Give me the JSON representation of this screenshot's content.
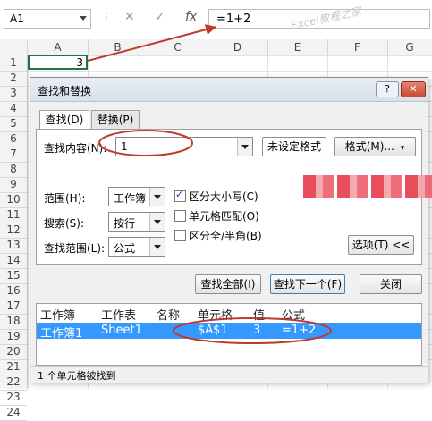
{
  "formula_bar": {
    "name_box": "A1",
    "separator": "⋮",
    "cancel_symbol": "✕",
    "enter_symbol": "✓",
    "fx_symbol": "fx",
    "formula": "=1+2",
    "watermark": "Excel教程之家"
  },
  "sheet": {
    "columns": [
      "A",
      "B",
      "C",
      "D",
      "E",
      "F",
      "G"
    ],
    "rows": [
      "1",
      "2",
      "3",
      "4",
      "5",
      "6",
      "7",
      "8",
      "9",
      "10",
      "11",
      "12",
      "13",
      "14",
      "15",
      "16",
      "17",
      "18",
      "19",
      "20",
      "21",
      "22",
      "23",
      "24"
    ],
    "a1_value": "3"
  },
  "dialog": {
    "title": "查找和替换",
    "help_label": "?",
    "close_label": "✕",
    "tabs": [
      "查找(D)",
      "替换(P)"
    ],
    "find_what_label": "查找内容(N):",
    "find_what_value": "1",
    "no_format_label": "未设定格式",
    "format_button": "格式(M)...",
    "within_label": "范围(H):",
    "within_value": "工作簿",
    "search_label": "搜索(S):",
    "search_value": "按行",
    "look_in_label": "查找范围(L):",
    "look_in_value": "公式",
    "match_case_label": "区分大小写(C)",
    "match_case_checked": true,
    "match_entire_label": "单元格匹配(O)",
    "match_width_label": "区分全/半角(B)",
    "options_button": "选项(T) <<",
    "find_all_button": "查找全部(I)",
    "find_next_button": "查找下一个(F)",
    "close_button": "关闭",
    "results_headers": [
      "工作簿",
      "工作表",
      "名称",
      "单元格",
      "值",
      "公式"
    ],
    "results_row": [
      "工作簿1",
      "Sheet1",
      "",
      "$A$1",
      "3",
      "=1+2"
    ],
    "status": "1 个单元格被找到"
  },
  "colors": {
    "selection": "#3399ff",
    "annotation_red": "#c0392b",
    "active_cell_border": "#217346"
  }
}
